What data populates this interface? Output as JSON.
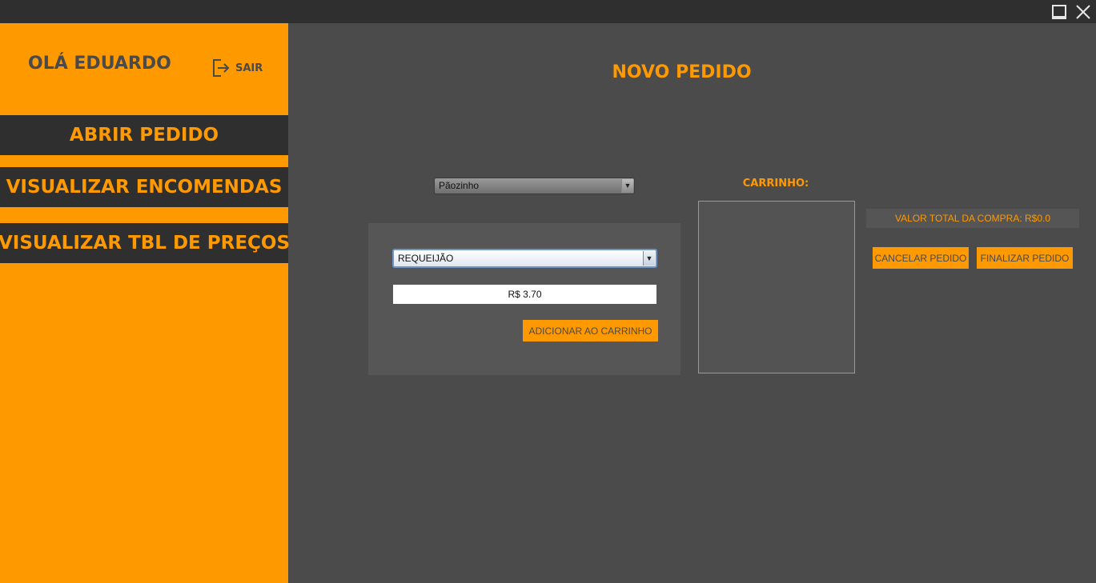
{
  "window": {
    "controls": [
      "maximize-icon",
      "close-icon"
    ]
  },
  "sidebar": {
    "greeting": "OLÁ EDUARDO",
    "logout_label": "SAIR",
    "nav": [
      {
        "label": "ABRIR PEDIDO"
      },
      {
        "label": "VISUALIZAR ENCOMENDAS"
      },
      {
        "label": "VISUALIZAR TBL DE PREÇOS"
      }
    ]
  },
  "main": {
    "title": "NOVO PEDIDO",
    "bread_select": {
      "value": "Pãozinho"
    },
    "item_select": {
      "value": "REQUEIJÃO"
    },
    "price": "R$ 3.70",
    "add_button": "ADICIONAR AO CARRINHO",
    "cart": {
      "title": "CARRINHO:",
      "items": []
    },
    "total": "VALOR TOTAL DA COMPRA: R$0.0",
    "cancel_button": "CANCELAR PEDIDO",
    "finish_button": "FINALIZAR PEDIDO"
  },
  "colors": {
    "accent": "#ff9900",
    "sidebar_nav_bg": "#2f2f2f",
    "main_bg": "#4b4b4b",
    "panel_bg": "#565656",
    "dark_text": "#4a4a4a"
  }
}
